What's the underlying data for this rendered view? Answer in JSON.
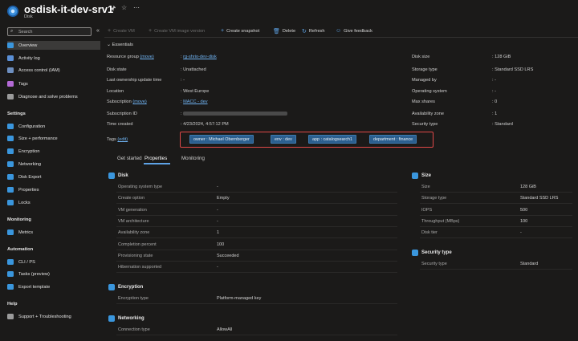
{
  "header": {
    "title": "osdisk-it-dev-srv1",
    "subtitle": "Disk",
    "pin_icon": "pin-icon",
    "star_icon": "star-icon",
    "more_icon": "ellipsis-icon"
  },
  "search": {
    "placeholder": "Search"
  },
  "sidebar": {
    "items": [
      {
        "label": "Overview",
        "icon": "disk-icon",
        "color": "#3a96dd"
      },
      {
        "label": "Activity log",
        "icon": "activity-log-icon",
        "color": "#5a8fd6"
      },
      {
        "label": "Access control (IAM)",
        "icon": "iam-icon",
        "color": "#6d8fc0"
      },
      {
        "label": "Tags",
        "icon": "tag-icon",
        "color": "#b46ad6"
      },
      {
        "label": "Diagnose and solve problems",
        "icon": "diagnose-icon",
        "color": "#9b9b9b"
      }
    ],
    "settings_title": "Settings",
    "settings_items": [
      {
        "label": "Configuration",
        "icon": "configuration-icon",
        "color": "#3a96dd"
      },
      {
        "label": "Size + performance",
        "icon": "size-icon",
        "color": "#3a96dd"
      },
      {
        "label": "Encryption",
        "icon": "encryption-icon",
        "color": "#3a96dd"
      },
      {
        "label": "Networking",
        "icon": "networking-icon",
        "color": "#3a96dd"
      },
      {
        "label": "Disk Export",
        "icon": "export-icon",
        "color": "#3a96dd"
      },
      {
        "label": "Properties",
        "icon": "properties-icon",
        "color": "#3a96dd"
      },
      {
        "label": "Locks",
        "icon": "lock-icon",
        "color": "#3a96dd"
      }
    ],
    "monitoring_title": "Monitoring",
    "monitoring_items": [
      {
        "label": "Metrics",
        "icon": "metrics-icon",
        "color": "#3a96dd"
      }
    ],
    "automation_title": "Automation",
    "automation_items": [
      {
        "label": "CLI / PS",
        "icon": "cli-icon",
        "color": "#3a96dd"
      },
      {
        "label": "Tasks (preview)",
        "icon": "tasks-icon",
        "color": "#3a96dd"
      },
      {
        "label": "Export template",
        "icon": "template-icon",
        "color": "#3a96dd"
      }
    ],
    "help_title": "Help",
    "help_items": [
      {
        "label": "Support + Troubleshooting",
        "icon": "support-icon",
        "color": "#9b9b9b"
      }
    ]
  },
  "toolbar": {
    "create_vm": "Create VM",
    "create_vm_image": "Create VM image version",
    "create_snapshot": "Create snapshot",
    "delete": "Delete",
    "refresh": "Refresh",
    "give_feedback": "Give feedback"
  },
  "essentials": {
    "toggle_label": "Essentials",
    "left": [
      {
        "key": "Resource group",
        "key_link": "(move)",
        "value": "rg-shrio-dev-disk",
        "value_is_link": true
      },
      {
        "key": "Disk state",
        "value": "Unattached"
      },
      {
        "key": "Last ownership update time",
        "value": "-"
      },
      {
        "key": "Location",
        "value": "West Europe"
      },
      {
        "key": "Subscription",
        "key_link": "(move)",
        "value": "MACC - dev",
        "value_is_link": true
      },
      {
        "key": "Subscription ID",
        "value": ""
      },
      {
        "key": "Time created",
        "value": "4/23/2024, 4:57:12 PM"
      }
    ],
    "right": [
      {
        "key": "Disk size",
        "value": "128 GiB"
      },
      {
        "key": "Storage type",
        "value": "Standard SSD LRS"
      },
      {
        "key": "Managed by",
        "value": "-"
      },
      {
        "key": "Operating system",
        "value": "-"
      },
      {
        "key": "Max shares",
        "value": "0"
      },
      {
        "key": "Availability zone",
        "value": "1"
      },
      {
        "key": "Security type",
        "value": "Standard"
      }
    ],
    "tags_label": "Tags",
    "tags_edit": "(edit)",
    "tags": [
      "owner : Michael Obernberger",
      "env : dev",
      "app : catalogsearch1",
      "department : finance"
    ]
  },
  "tabs": [
    "Get started",
    "Properties",
    "Monitoring"
  ],
  "disk_section": {
    "title": "Disk",
    "rows": [
      {
        "key": "Operating system type",
        "value": "-"
      },
      {
        "key": "Create option",
        "value": "Empty"
      },
      {
        "key": "VM generation",
        "value": "-"
      },
      {
        "key": "VM architecture",
        "value": "-"
      },
      {
        "key": "Availability zone",
        "value": "1"
      },
      {
        "key": "Completion percent",
        "value": "100"
      },
      {
        "key": "Provisioning state",
        "value": "Succeeded"
      },
      {
        "key": "Hibernation supported",
        "value": "-"
      }
    ]
  },
  "encryption_section": {
    "title": "Encryption",
    "rows": [
      {
        "key": "Encryption type",
        "value": "Platform-managed key"
      }
    ]
  },
  "networking_section": {
    "title": "Networking",
    "rows": [
      {
        "key": "Connection type",
        "value": "AllowAll"
      }
    ]
  },
  "size_section": {
    "title": "Size",
    "rows": [
      {
        "key": "Size",
        "value": "128 GiB"
      },
      {
        "key": "Storage type",
        "value": "Standard SSD LRS"
      },
      {
        "key": "IOPS",
        "value": "500"
      },
      {
        "key": "Throughput (MBps)",
        "value": "100"
      },
      {
        "key": "Disk tier",
        "value": "-"
      }
    ]
  },
  "security_section": {
    "title": "Security type",
    "rows": [
      {
        "key": "Security type",
        "value": "Standard"
      }
    ]
  },
  "colors": {
    "accent": "#5ea3e6",
    "tag_bg": "#2b5f8f",
    "highlight_box": "#e04848"
  }
}
